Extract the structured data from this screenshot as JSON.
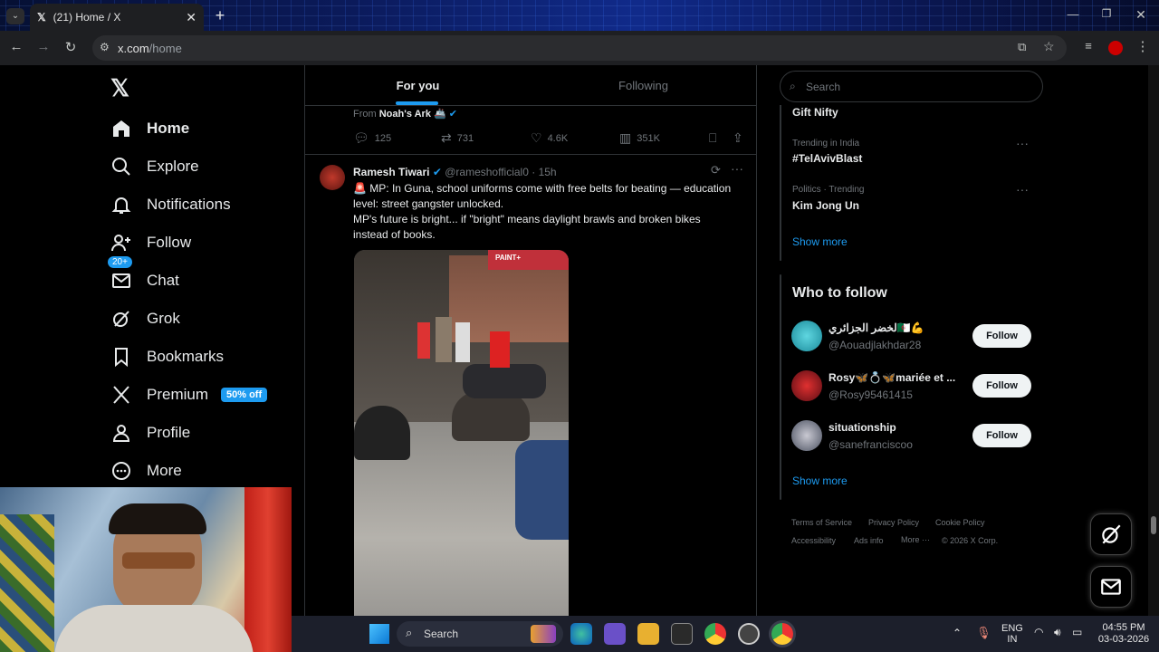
{
  "browser": {
    "tab_title": "(21) Home / X",
    "url_host": "x.com",
    "url_path": "/home"
  },
  "nav": {
    "items": [
      {
        "label": "Home",
        "icon": "home-icon"
      },
      {
        "label": "Explore",
        "icon": "search-icon"
      },
      {
        "label": "Notifications",
        "icon": "bell-icon"
      },
      {
        "label": "Follow",
        "icon": "person-plus-icon"
      },
      {
        "label": "Chat",
        "icon": "envelope-icon"
      },
      {
        "label": "Grok",
        "icon": "grok-icon"
      },
      {
        "label": "Bookmarks",
        "icon": "bookmark-icon"
      },
      {
        "label": "Premium",
        "icon": "x-logo-icon"
      },
      {
        "label": "Profile",
        "icon": "person-icon"
      },
      {
        "label": "More",
        "icon": "more-circle-icon"
      }
    ],
    "notif_badge": "20+",
    "premium_badge": "50% off"
  },
  "timeline": {
    "tabs": [
      "For you",
      "Following"
    ],
    "prev_post": {
      "from_label": "From",
      "from_name": "Noah's Ark 🚢",
      "replies": "125",
      "reposts": "731",
      "likes": "4.6K",
      "views": "351K"
    },
    "post": {
      "author": "Ramesh Tiwari",
      "handle": "@rameshofficial0",
      "time": "· 15h",
      "line1": "🚨 MP: In Guna, school uniforms come with free belts for beating — education level: street gangster unlocked.",
      "line2": "MP's future is bright... if \"bright\" means daylight brawls and broken bikes instead of books.",
      "video_sign": "PAINT+"
    }
  },
  "sidebar": {
    "search_placeholder": "Search",
    "trends": [
      {
        "meta": "",
        "name": "Gift Nifty"
      },
      {
        "meta": "Trending in India",
        "name": "#TelAvivBlast"
      },
      {
        "meta": "Politics · Trending",
        "name": "Kim Jong Un"
      }
    ],
    "show_more": "Show more",
    "who_to_follow_title": "Who to follow",
    "suggestions": [
      {
        "name": "لخضر الجزائري🇩🇿💪",
        "handle": "@Aouadjlakhdar28",
        "button": "Follow"
      },
      {
        "name": "Rosy🦋💍🦋mariée et ...",
        "handle": "@Rosy95461415",
        "button": "Follow"
      },
      {
        "name": "situationship",
        "handle": "@sanefranciscoo",
        "button": "Follow"
      }
    ],
    "footer_links": [
      "Terms of Service",
      "Privacy Policy",
      "Cookie Policy",
      "Accessibility",
      "Ads info",
      "More ···",
      "© 2026 X Corp."
    ]
  },
  "taskbar": {
    "search_label": "Search",
    "lang_top": "ENG",
    "lang_bottom": "IN",
    "time": "04:55 PM",
    "date": "03-03-2026"
  }
}
